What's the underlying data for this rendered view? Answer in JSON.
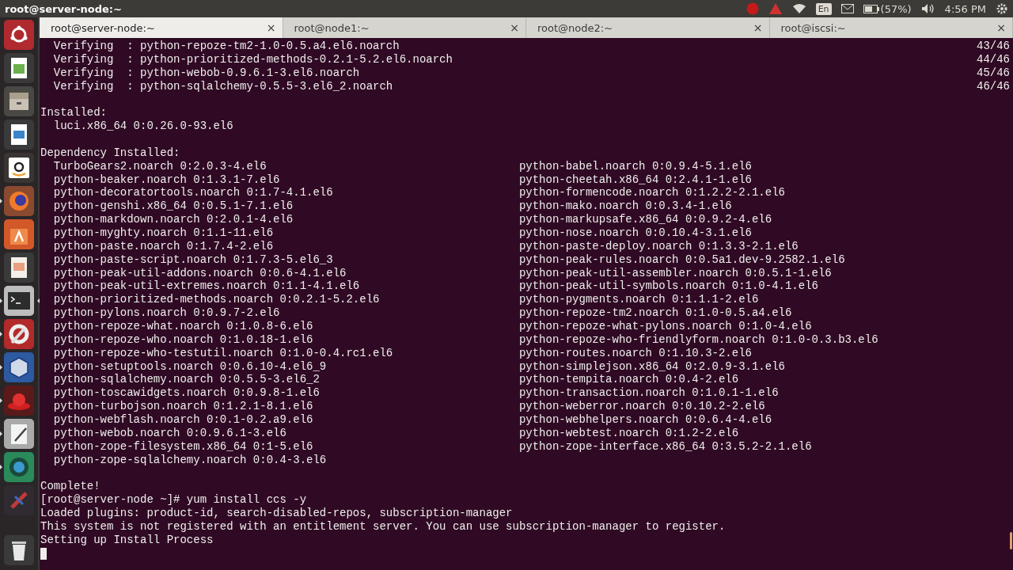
{
  "top_bar": {
    "title": "root@server-node:~",
    "keyboard": "En",
    "battery": "(57%)",
    "time": "4:56 PM"
  },
  "launcher": [
    {
      "kind": "ubuntu",
      "running": false,
      "focused": false
    },
    {
      "kind": "spreadsheet",
      "running": false,
      "focused": false
    },
    {
      "kind": "files",
      "running": false,
      "focused": false
    },
    {
      "kind": "document",
      "running": false,
      "focused": false
    },
    {
      "kind": "shop",
      "running": false,
      "focused": false
    },
    {
      "kind": "browser",
      "running": true,
      "focused": false
    },
    {
      "kind": "software",
      "running": false,
      "focused": false
    },
    {
      "kind": "presentation",
      "running": false,
      "focused": false
    },
    {
      "kind": "terminal",
      "running": true,
      "focused": true
    },
    {
      "kind": "settings",
      "running": true,
      "focused": false
    },
    {
      "kind": "virtualbox",
      "running": true,
      "focused": false
    },
    {
      "kind": "hat",
      "running": true,
      "focused": false
    },
    {
      "kind": "editor",
      "running": true,
      "focused": false
    },
    {
      "kind": "globe",
      "running": true,
      "focused": false
    },
    {
      "kind": "tool",
      "running": false,
      "focused": false
    },
    {
      "kind": "trash",
      "running": false,
      "focused": false
    }
  ],
  "tabs": [
    {
      "label": "root@server-node:~",
      "close": "×",
      "selected": true
    },
    {
      "label": "root@node1:~",
      "close": "×",
      "selected": false
    },
    {
      "label": "root@node2:~",
      "close": "×",
      "selected": false
    },
    {
      "label": "root@iscsi:~",
      "close": "×",
      "selected": false
    }
  ],
  "terminal": {
    "lines": [
      {
        "kind": "progress",
        "text": "  Verifying  : python-repoze-tm2-1.0-0.5.a4.el6.noarch",
        "count": "43/46"
      },
      {
        "kind": "progress",
        "text": "  Verifying  : python-prioritized-methods-0.2.1-5.2.el6.noarch",
        "count": "44/46"
      },
      {
        "kind": "progress",
        "text": "  Verifying  : python-webob-0.9.6.1-3.el6.noarch",
        "count": "45/46"
      },
      {
        "kind": "progress",
        "text": "  Verifying  : python-sqlalchemy-0.5.5-3.el6_2.noarch",
        "count": "46/46"
      },
      {
        "kind": "blank"
      },
      {
        "kind": "text",
        "text": "Installed:"
      },
      {
        "kind": "text",
        "text": "  luci.x86_64 0:0.26.0-93.el6"
      },
      {
        "kind": "blank"
      },
      {
        "kind": "text",
        "text": "Dependency Installed:"
      },
      {
        "kind": "columns",
        "left": "TurboGears2.noarch 0:2.0.3-4.el6",
        "right": "python-babel.noarch 0:0.9.4-5.1.el6"
      },
      {
        "kind": "columns",
        "left": "python-beaker.noarch 0:1.3.1-7.el6",
        "right": "python-cheetah.x86_64 0:2.4.1-1.el6"
      },
      {
        "kind": "columns",
        "left": "python-decoratortools.noarch 0:1.7-4.1.el6",
        "right": "python-formencode.noarch 0:1.2.2-2.1.el6"
      },
      {
        "kind": "columns",
        "left": "python-genshi.x86_64 0:0.5.1-7.1.el6",
        "right": "python-mako.noarch 0:0.3.4-1.el6"
      },
      {
        "kind": "columns",
        "left": "python-markdown.noarch 0:2.0.1-4.el6",
        "right": "python-markupsafe.x86_64 0:0.9.2-4.el6"
      },
      {
        "kind": "columns",
        "left": "python-myghty.noarch 0:1.1-11.el6",
        "right": "python-nose.noarch 0:0.10.4-3.1.el6"
      },
      {
        "kind": "columns",
        "left": "python-paste.noarch 0:1.7.4-2.el6",
        "right": "python-paste-deploy.noarch 0:1.3.3-2.1.el6"
      },
      {
        "kind": "columns",
        "left": "python-paste-script.noarch 0:1.7.3-5.el6_3",
        "right": "python-peak-rules.noarch 0:0.5a1.dev-9.2582.1.el6"
      },
      {
        "kind": "columns",
        "left": "python-peak-util-addons.noarch 0:0.6-4.1.el6",
        "right": "python-peak-util-assembler.noarch 0:0.5.1-1.el6"
      },
      {
        "kind": "columns",
        "left": "python-peak-util-extremes.noarch 0:1.1-4.1.el6",
        "right": "python-peak-util-symbols.noarch 0:1.0-4.1.el6"
      },
      {
        "kind": "columns",
        "left": "python-prioritized-methods.noarch 0:0.2.1-5.2.el6",
        "right": "python-pygments.noarch 0:1.1.1-2.el6"
      },
      {
        "kind": "columns",
        "left": "python-pylons.noarch 0:0.9.7-2.el6",
        "right": "python-repoze-tm2.noarch 0:1.0-0.5.a4.el6"
      },
      {
        "kind": "columns",
        "left": "python-repoze-what.noarch 0:1.0.8-6.el6",
        "right": "python-repoze-what-pylons.noarch 0:1.0-4.el6"
      },
      {
        "kind": "columns",
        "left": "python-repoze-who.noarch 0:1.0.18-1.el6",
        "right": "python-repoze-who-friendlyform.noarch 0:1.0-0.3.b3.el6"
      },
      {
        "kind": "columns",
        "left": "python-repoze-who-testutil.noarch 0:1.0-0.4.rc1.el6",
        "right": "python-routes.noarch 0:1.10.3-2.el6"
      },
      {
        "kind": "columns",
        "left": "python-setuptools.noarch 0:0.6.10-4.el6_9",
        "right": "python-simplejson.x86_64 0:2.0.9-3.1.el6"
      },
      {
        "kind": "columns",
        "left": "python-sqlalchemy.noarch 0:0.5.5-3.el6_2",
        "right": "python-tempita.noarch 0:0.4-2.el6"
      },
      {
        "kind": "columns",
        "left": "python-toscawidgets.noarch 0:0.9.8-1.el6",
        "right": "python-transaction.noarch 0:1.0.1-1.el6"
      },
      {
        "kind": "columns",
        "left": "python-turbojson.noarch 0:1.2.1-8.1.el6",
        "right": "python-weberror.noarch 0:0.10.2-2.el6"
      },
      {
        "kind": "columns",
        "left": "python-webflash.noarch 0:0.1-0.2.a9.el6",
        "right": "python-webhelpers.noarch 0:0.6.4-4.el6"
      },
      {
        "kind": "columns",
        "left": "python-webob.noarch 0:0.9.6.1-3.el6",
        "right": "python-webtest.noarch 0:1.2-2.el6"
      },
      {
        "kind": "columns",
        "left": "python-zope-filesystem.x86_64 0:1-5.el6",
        "right": "python-zope-interface.x86_64 0:3.5.2-2.1.el6"
      },
      {
        "kind": "columns",
        "left": "python-zope-sqlalchemy.noarch 0:0.4-3.el6"
      },
      {
        "kind": "blank"
      },
      {
        "kind": "text",
        "text": "Complete!"
      },
      {
        "kind": "text",
        "text": "[root@server-node ~]# yum install ccs -y"
      },
      {
        "kind": "text",
        "text": "Loaded plugins: product-id, search-disabled-repos, subscription-manager"
      },
      {
        "kind": "text",
        "text": "This system is not registered with an entitlement server. You can use subscription-manager to register."
      },
      {
        "kind": "text",
        "text": "Setting up Install Process"
      },
      {
        "kind": "cursor"
      }
    ]
  }
}
